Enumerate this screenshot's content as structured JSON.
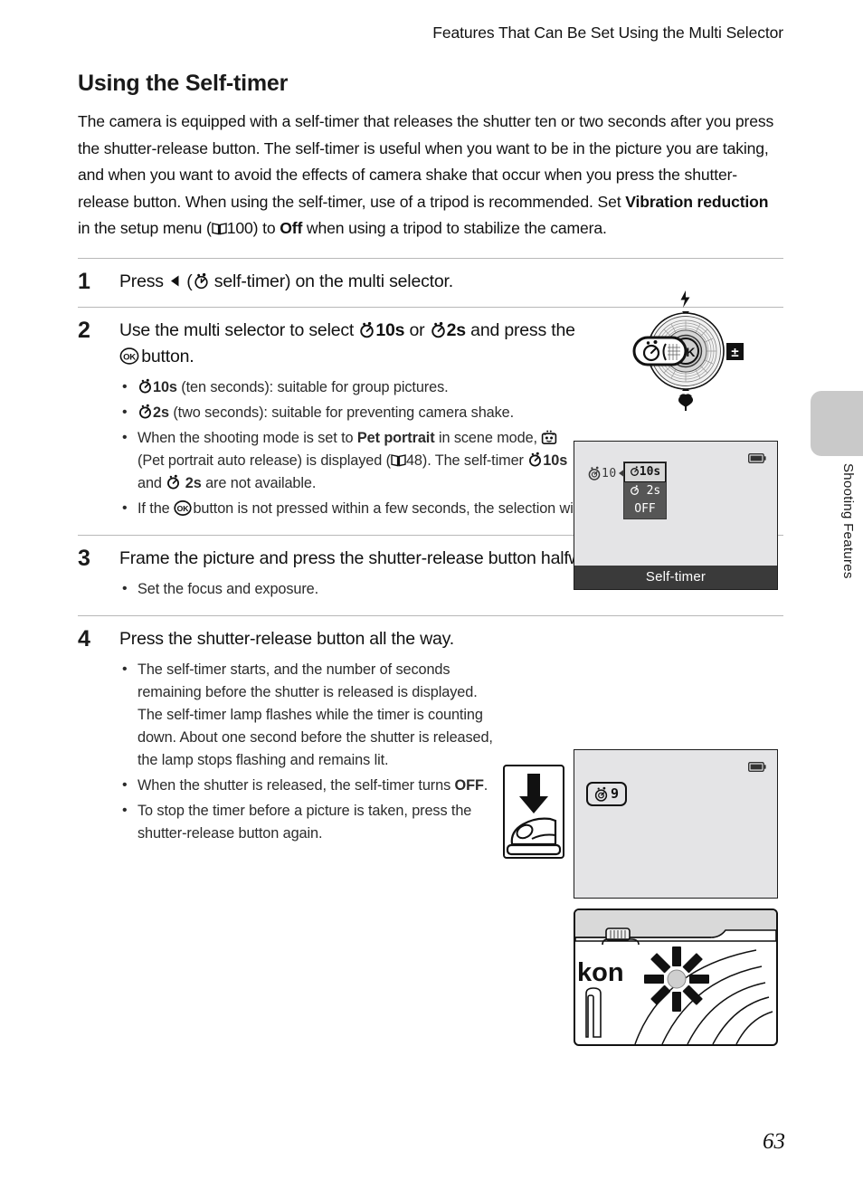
{
  "header": {
    "running_title": "Features That Can Be Set Using the Multi Selector"
  },
  "section": {
    "title": "Using the Self-timer",
    "intro_part1": "The camera is equipped with a self-timer that releases the shutter ten or two seconds after you press the shutter-release button.  The self-timer is useful when you want to be in the picture you are taking, and when you want to avoid the effects of camera shake that occur when you press the shutter-release button. When using the self-timer, use of a tripod is recommended. Set ",
    "intro_bold1": "Vibration reduction",
    "intro_part2": " in the setup menu (",
    "intro_page_ref": "100",
    "intro_part3": ") to ",
    "intro_bold2": "Off",
    "intro_part4": " when using a tripod to stabilize the camera."
  },
  "steps": [
    {
      "number": "1",
      "head_part1": "Press ",
      "head_part2": " (",
      "head_part3": " self-timer) on the multi selector.",
      "bullets": []
    },
    {
      "number": "2",
      "head_part1": "Use the multi selector to select ",
      "head_bold1": "10s",
      "head_part2": " or ",
      "head_bold2": "2s",
      "head_part3": " and press the ",
      "head_part4": " button.",
      "bullets": [
        {
          "bold1": "10s",
          "text1": " (ten seconds): suitable for group pictures."
        },
        {
          "bold1": "2s",
          "text1": " (two seconds): suitable for preventing camera shake."
        },
        {
          "text_a": "When the shooting mode is set to ",
          "bold_a": "Pet portrait",
          "text_b": " in scene mode, ",
          "text_c": " (Pet portrait auto release) is displayed (",
          "page_ref": "48",
          "text_d": "). The self-timer ",
          "bold_b": "10s",
          "text_e": " and ",
          "bold_c": "2s",
          "text_f": " are not available."
        },
        {
          "text_a": "If the ",
          "text_b": " button is not pressed within a few seconds, the selection will be canceled."
        }
      ]
    },
    {
      "number": "3",
      "head": "Frame the picture and press the shutter-release button halfway.",
      "bullets": [
        {
          "text": "Set the focus and exposure."
        }
      ]
    },
    {
      "number": "4",
      "head": "Press the shutter-release button all the way.",
      "bullets": [
        {
          "text": "The self-timer starts, and the number of seconds remaining before the shutter is released is displayed. The self-timer lamp flashes while the timer is counting down. About one second before the shutter is released, the lamp stops flashing and remains lit."
        },
        {
          "text_a": "When the shutter is released, the self-timer turns ",
          "bold_a": "OFF",
          "text_b": "."
        },
        {
          "text": "To stop the timer before a picture is taken, press the shutter-release button again."
        }
      ]
    }
  ],
  "figures": {
    "multi_selector": {
      "center_label": "OK",
      "top_icon": "flash-icon",
      "left_icon": "self-timer-icon",
      "right_icon": "exposure-compensation-icon",
      "bottom_icon": "macro-icon"
    },
    "lcd_menu": {
      "indicator_text": "10",
      "options": [
        "10s",
        "2s",
        "OFF"
      ],
      "selected": "10s",
      "caption": "Self-timer",
      "battery_icon": "battery-icon"
    },
    "lcd_countdown": {
      "countdown_value": "9",
      "battery_icon": "battery-icon"
    },
    "camera_front": {
      "brand_partial": "kon",
      "lamp_state": "flashing"
    }
  },
  "thumb_tab": {
    "label": "Shooting Features"
  },
  "footer": {
    "page_number": "63"
  },
  "colors": {
    "lcd_background": "#e4e4e6",
    "lcd_caption_bar": "#3a3a3a",
    "menu_background": "#565656",
    "menu_selected": "#d7d7d7",
    "thumb_tab": "#c9c9c9",
    "divider": "#b8b8b8"
  }
}
